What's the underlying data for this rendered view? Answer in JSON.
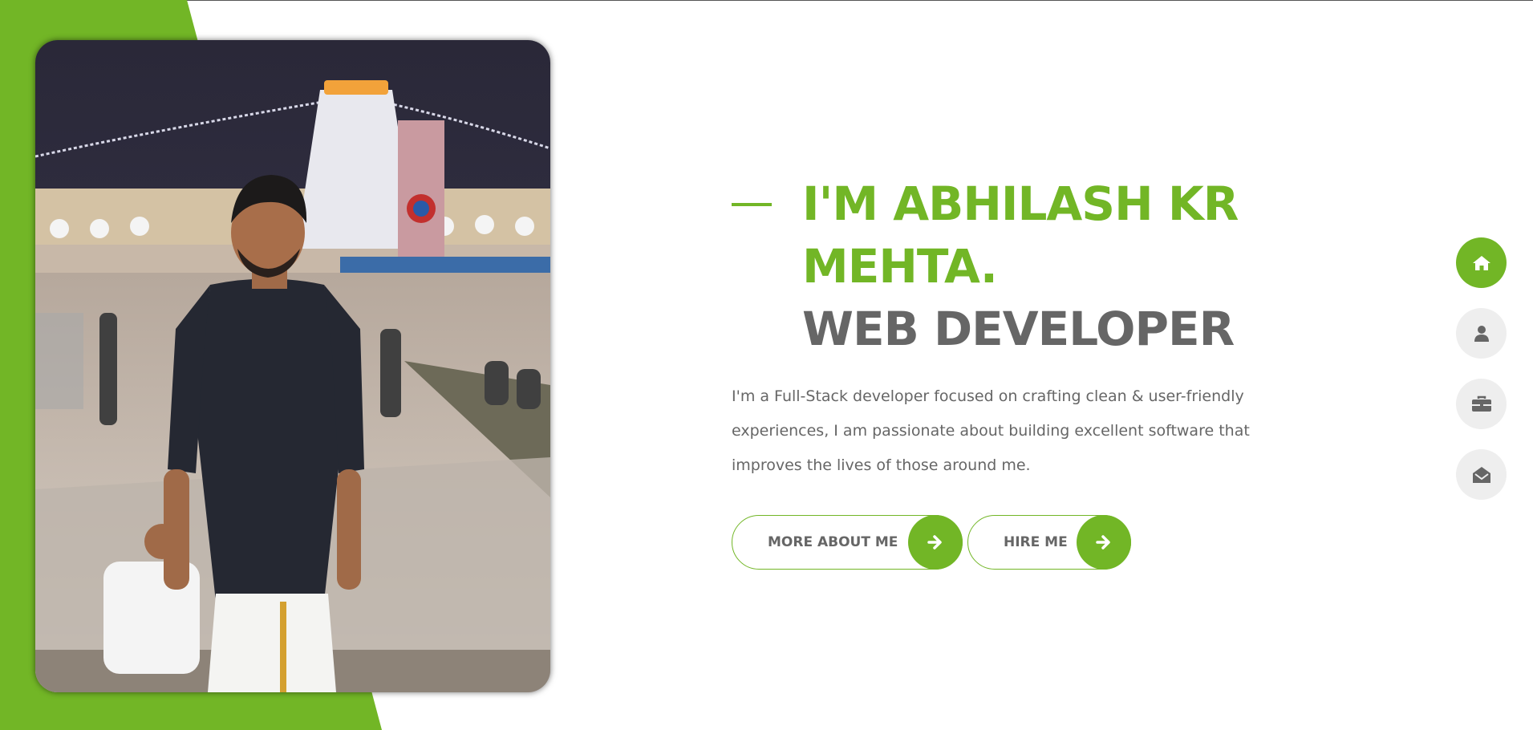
{
  "hero": {
    "name_line1": "I'M ABHILASH KR",
    "name_line2": "MEHTA.",
    "role": "WEB DEVELOPER",
    "bio": "I'm a Full-Stack developer focused on crafting clean & user-friendly experiences, I am passionate about building excellent software that improves the lives of those around me.",
    "more_button": "MORE ABOUT ME",
    "hire_button": "HIRE ME",
    "arrow_icon": "arrow-right-icon"
  },
  "side_nav": [
    {
      "icon": "home-icon",
      "active": true
    },
    {
      "icon": "user-icon",
      "active": false
    },
    {
      "icon": "briefcase-icon",
      "active": false
    },
    {
      "icon": "envelope-open-icon",
      "active": false
    }
  ],
  "colors": {
    "accent": "#72b626",
    "text": "#666666",
    "nav_inactive": "#eeeeee",
    "icon_inactive": "#666666"
  }
}
